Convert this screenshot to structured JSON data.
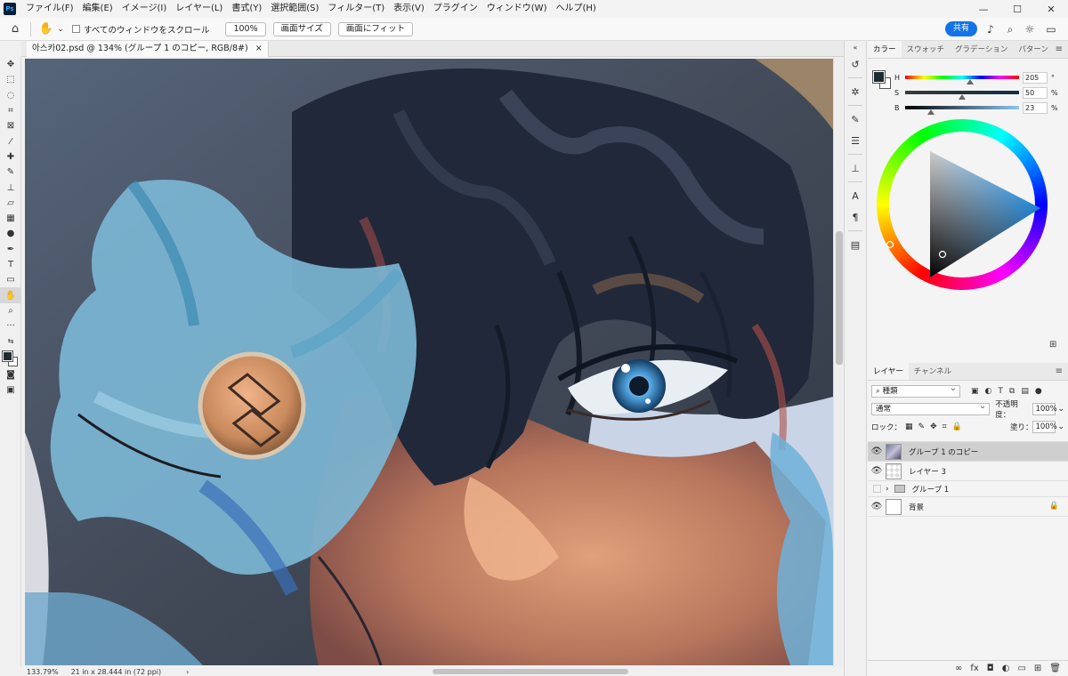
{
  "app": {
    "logo": "Ps",
    "menu": [
      "ファイル(F)",
      "編集(E)",
      "イメージ(I)",
      "レイヤー(L)",
      "書式(Y)",
      "選択範囲(S)",
      "フィルター(T)",
      "表示(V)",
      "プラグイン",
      "ウィンドウ(W)",
      "ヘルプ(H)"
    ],
    "window_controls": {
      "minimize": "—",
      "maximize": "☐",
      "close": "✕"
    }
  },
  "options": {
    "home_icon": "home-icon",
    "hand_icon": "hand-icon",
    "scroll_all_label": "すべてのウィンドウをスクロール",
    "zoom_100": "100%",
    "fit_screen_size": "画面サイズ",
    "fit_screen": "画面にフィット",
    "share": "共有"
  },
  "document": {
    "tab_title": "아스카02.psd @ 134% (グループ 1 のコピー, RGB/8#)",
    "close": "×"
  },
  "status": {
    "zoom": "133.79%",
    "doc_size": "21 in x 28.444 in (72 ppi)"
  },
  "color_panel": {
    "tabs": [
      "カラー",
      "スウォッチ",
      "グラデーション",
      "パターン"
    ],
    "active_tab": 0,
    "hsb": [
      {
        "label": "H",
        "value": "205",
        "unit": "°",
        "fraction": 0.57
      },
      {
        "label": "S",
        "value": "50",
        "unit": "%",
        "fraction": 0.5
      },
      {
        "label": "B",
        "value": "23",
        "unit": "%",
        "fraction": 0.23
      }
    ],
    "foreground_color": "#1e2b33",
    "hue_color": "#2aa0f0"
  },
  "layers_panel": {
    "tabs": [
      "レイヤー",
      "チャンネル"
    ],
    "active_tab": 0,
    "filter_kind": "種類",
    "blend_mode": "通常",
    "opacity_label": "不透明度：",
    "opacity": "100%",
    "lock_label": "ロック：",
    "fill_label": "塗り：",
    "fill": "100%",
    "layers": [
      {
        "name": "グループ 1 のコピー",
        "visible": true,
        "selected": true,
        "thumb": "img"
      },
      {
        "name": "レイヤー 3",
        "visible": true,
        "selected": false,
        "thumb": "checker"
      },
      {
        "name": "グループ 1",
        "visible": false,
        "selected": false,
        "thumb": "folder"
      },
      {
        "name": "背景",
        "visible": true,
        "selected": false,
        "thumb": "white",
        "locked": true
      }
    ]
  }
}
